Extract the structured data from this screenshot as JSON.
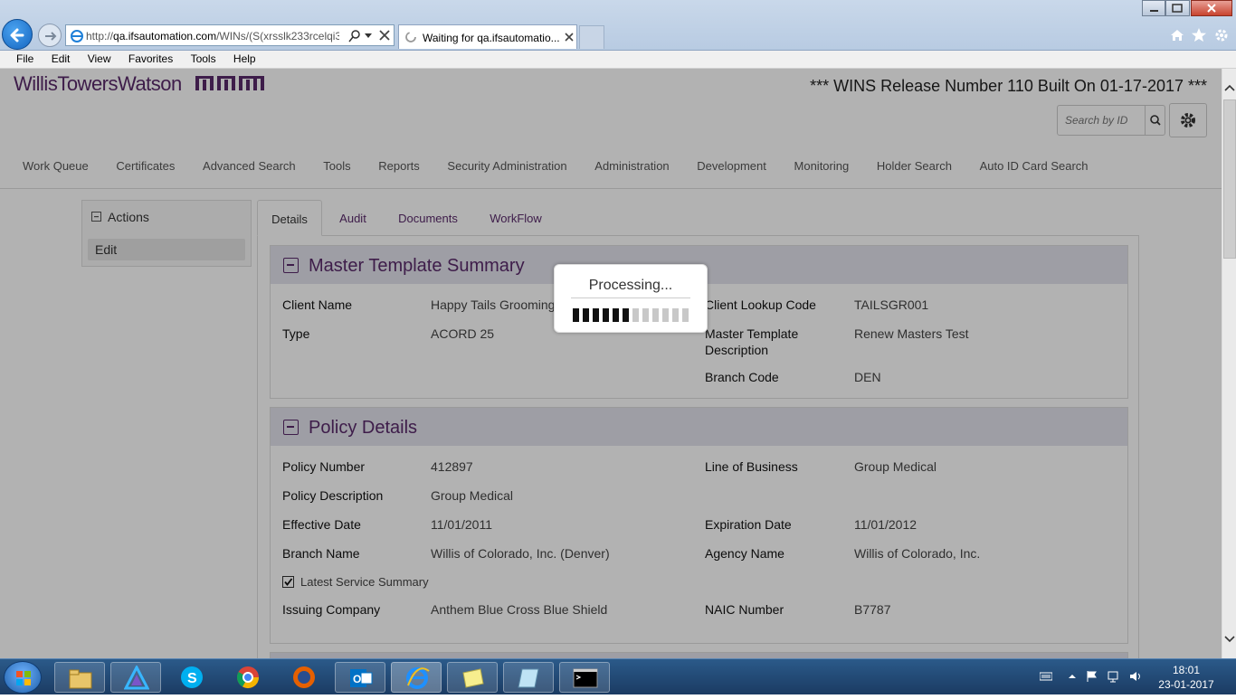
{
  "browser": {
    "address": "http://qa.ifsautomation.com/WINs/(S(xrsslk233rcelqi3",
    "address_domain": "qa.ifsautomation.com",
    "address_prefix": "http://",
    "address_suffix": "/WINs/(S(xrsslk233rcelqi3",
    "tab_title": "Waiting for qa.ifsautomatio...",
    "menu": [
      "File",
      "Edit",
      "View",
      "Favorites",
      "Tools",
      "Help"
    ]
  },
  "header": {
    "logo_text": "WillisTowersWatson",
    "release": "*** WINS Release Number 110 Built On 01-17-2017 ***",
    "search_placeholder": "Search by ID"
  },
  "nav": [
    "Work Queue",
    "Certificates",
    "Advanced Search",
    "Tools",
    "Reports",
    "Security Administration",
    "Administration",
    "Development",
    "Monitoring",
    "Holder Search",
    "Auto ID Card Search"
  ],
  "actions": {
    "title": "Actions",
    "edit": "Edit"
  },
  "tabs": [
    "Details",
    "Audit",
    "Documents",
    "WorkFlow"
  ],
  "master_template": {
    "title": "Master Template Summary",
    "client_name_label": "Client Name",
    "client_name": "Happy Tails Grooming",
    "type_label": "Type",
    "type": "ACORD 25",
    "client_lookup_label": "Client Lookup Code",
    "client_lookup": "TAILSGR001",
    "mt_desc_label_1": "Master Template",
    "mt_desc_label_2": "Description",
    "mt_desc": "Renew Masters Test",
    "branch_code_label": "Branch Code",
    "branch_code": "DEN"
  },
  "policy": {
    "title": "Policy Details",
    "policy_number_label": "Policy Number",
    "policy_number": "412897",
    "lob_label": "Line of Business",
    "lob": "Group Medical",
    "policy_desc_label": "Policy Description",
    "policy_desc": "Group Medical",
    "effective_label": "Effective Date",
    "effective": "11/01/2011",
    "expiration_label": "Expiration Date",
    "expiration": "11/01/2012",
    "branch_name_label": "Branch Name",
    "branch_name": "Willis of Colorado, Inc. (Denver)",
    "agency_label": "Agency Name",
    "agency": "Willis of Colorado, Inc.",
    "latest_service_label": "Latest Service Summary",
    "latest_service_checked": true,
    "issuing_label": "Issuing Company",
    "issuing": "Anthem Blue Cross Blue Shield",
    "naic_label": "NAIC Number",
    "naic": "B7787"
  },
  "processing": {
    "text": "Processing...",
    "progress": 0.5
  },
  "taskbar": {
    "time": "18:01",
    "date": "23-01-2017"
  },
  "colors": {
    "brand": "#5a2a6b",
    "panel_header": "#e2e2ec"
  }
}
